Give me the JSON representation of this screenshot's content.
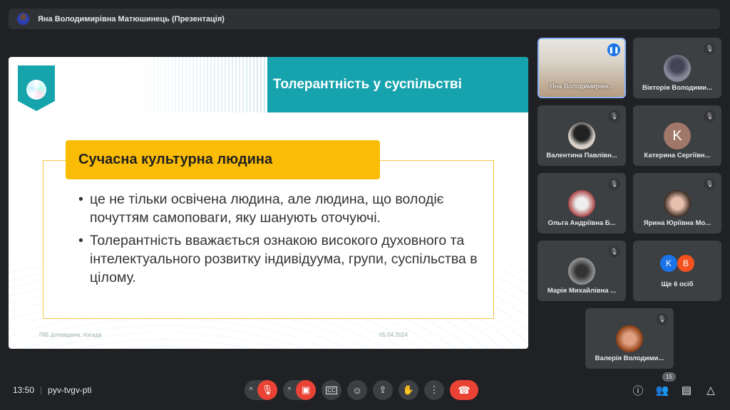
{
  "presenter_bar": {
    "label": "Яна Володимирівна Матюшинець (Презентація)"
  },
  "slide": {
    "title": "Толерантність у суспільстві",
    "heading": "Сучасна культурна людина",
    "bullets": [
      "це не тільки освічена людина, але людина, що володіє почуттям самоповаги, яку шанують оточуючі.",
      "Толерантність вважається ознакою високого духовного та інтелектуального розвитку індивідуума, групи, суспільства в цілому."
    ],
    "footer_left": "ПІБ доповідача, посада",
    "footer_date": "05.04.2024"
  },
  "participants": [
    {
      "name": "Яна Володимирівн..."
    },
    {
      "name": "Вікторія Володими..."
    },
    {
      "name": "Валентина Павлівн..."
    },
    {
      "name": "Катерина Сергіївн...",
      "initial": "K"
    },
    {
      "name": "Ольга Андріївна Б..."
    },
    {
      "name": "Ярина Юріївна Мо..."
    },
    {
      "name": "Марія Михайлівна ..."
    },
    {
      "name": "Ще 6 осіб",
      "initials": [
        "K",
        "B"
      ]
    },
    {
      "name": "Валерія Володими..."
    }
  ],
  "bottom": {
    "time": "13:50",
    "meeting_code": "pyv-tvgv-pti",
    "people_count": "15"
  },
  "colors": {
    "accent": "#17a3ae",
    "yellow": "#fbbc05",
    "danger": "#ea4335"
  }
}
